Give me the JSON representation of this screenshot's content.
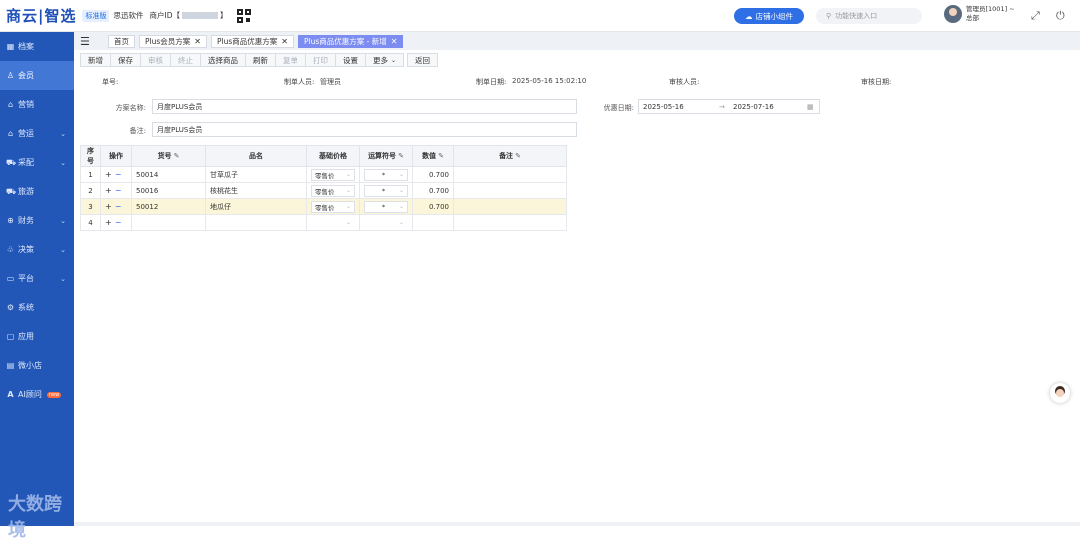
{
  "header": {
    "logo": "商云|智选",
    "edition": "标准版",
    "company": "思迅软件",
    "merchant_label": "商户ID【",
    "merchant_close": "】",
    "store_widget": "店铺小组件",
    "quick_entry_placeholder": "功能快速入口",
    "user_name": "管理员[1001] ~",
    "user_dept": "总部"
  },
  "sidebar": {
    "items": [
      {
        "label": "档案",
        "icon": "archive-icon"
      },
      {
        "label": "会员",
        "icon": "user-icon"
      },
      {
        "label": "营销",
        "icon": "marketing-icon"
      },
      {
        "label": "营运",
        "icon": "operations-icon"
      },
      {
        "label": "采配",
        "icon": "purchase-icon"
      },
      {
        "label": "旅游",
        "icon": "travel-icon"
      },
      {
        "label": "财务",
        "icon": "finance-icon"
      },
      {
        "label": "决策",
        "icon": "decision-icon"
      },
      {
        "label": "平台",
        "icon": "platform-icon"
      },
      {
        "label": "系统",
        "icon": "system-icon"
      },
      {
        "label": "应用",
        "icon": "apps-icon"
      },
      {
        "label": "微小店",
        "icon": "shop-icon"
      },
      {
        "label": "AI顾问",
        "icon": "ai-icon",
        "badge": "new"
      }
    ],
    "watermark": "大数跨境"
  },
  "tabs": [
    {
      "label": "首页",
      "closable": false
    },
    {
      "label": "Plus会员方案",
      "closable": true
    },
    {
      "label": "Plus商品优惠方案",
      "closable": true
    },
    {
      "label": "Plus商品优惠方案 - 新增",
      "closable": true,
      "active": true
    }
  ],
  "toolbar": {
    "new": "新增",
    "save": "保存",
    "review": "审核",
    "terminate": "终止",
    "select_product": "选择商品",
    "refresh": "刷新",
    "copy": "复单",
    "print": "打印",
    "settings": "设置",
    "more": "更多",
    "back": "返回"
  },
  "info": {
    "doc_no_label": "单号:",
    "creator_label": "制单人员:",
    "creator": "管理员",
    "create_date_label": "制单日期:",
    "create_date": "2025-05-16 15:02:10",
    "reviewer_label": "审核人员:",
    "review_date_label": "审核日期:"
  },
  "form": {
    "plan_name_label": "方案名称:",
    "plan_name": "月度PLUS会员",
    "remark_label": "备注:",
    "remark": "月度PLUS会员",
    "discount_date_label": "优惠日期:",
    "date_start": "2025-05-16",
    "date_sep": "→",
    "date_end": "2025-07-16"
  },
  "table": {
    "headers": [
      "序号",
      "操作",
      "货号",
      "品名",
      "基础价格",
      "运算符号",
      "数值",
      "备注"
    ],
    "rows": [
      {
        "no": "1",
        "code": "50014",
        "name": "甘草瓜子",
        "base": "零售价",
        "op": "*",
        "value": "0.700",
        "remark": ""
      },
      {
        "no": "2",
        "code": "50016",
        "name": "核桃花生",
        "base": "零售价",
        "op": "*",
        "value": "0.700",
        "remark": ""
      },
      {
        "no": "3",
        "code": "50012",
        "name": "地瓜仔",
        "base": "零售价",
        "op": "*",
        "value": "0.700",
        "remark": ""
      },
      {
        "no": "4",
        "code": "",
        "name": "",
        "base": "",
        "op": "",
        "value": "",
        "remark": ""
      }
    ]
  }
}
